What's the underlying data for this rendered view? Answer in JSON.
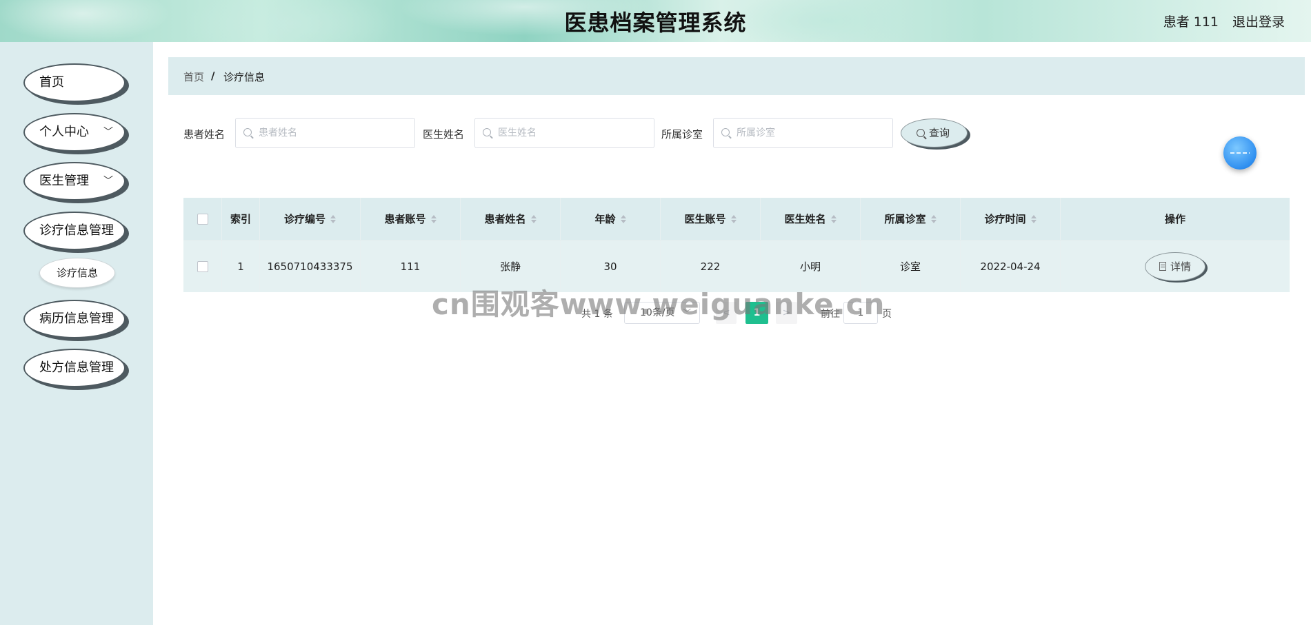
{
  "header": {
    "title": "医患档案管理系统",
    "user": "患者 111",
    "logout": "退出登录"
  },
  "sidebar": {
    "items": [
      {
        "label": "首页"
      },
      {
        "label": "个人中心",
        "chevron": "chevron-down-icon"
      },
      {
        "label": "医生管理",
        "chevron": "chevron-down-icon"
      },
      {
        "label": "诊疗信息管理"
      },
      {
        "label": "病历信息管理"
      },
      {
        "label": "处方信息管理"
      }
    ],
    "subitem": {
      "label": "诊疗信息"
    }
  },
  "breadcrumb": {
    "home": "首页",
    "separator": "/",
    "current": "诊疗信息"
  },
  "search": {
    "patient_name_label": "患者姓名",
    "patient_name_placeholder": "患者姓名",
    "doctor_name_label": "医生姓名",
    "doctor_name_placeholder": "医生姓名",
    "clinic_label": "所属诊室",
    "clinic_placeholder": "所属诊室",
    "query_label": "查询"
  },
  "table": {
    "columns": [
      "索引",
      "诊疗编号",
      "患者账号",
      "患者姓名",
      "年龄",
      "医生账号",
      "医生姓名",
      "所属诊室",
      "诊疗时间",
      "操作"
    ],
    "rows": [
      [
        "1",
        "1650710433375",
        "111",
        "张静",
        "30",
        "222",
        "小明",
        "诊室",
        "2022-04-24"
      ]
    ],
    "detail_label": "详情"
  },
  "pagination": {
    "total": "共 1 条",
    "page_size": "10条/页",
    "prev": "<",
    "current_page": "1",
    "next": ">",
    "goto": "前往",
    "goto_value": "1",
    "page": "页"
  },
  "watermark": "cn围观客www.weiguanke.cn",
  "colors": {
    "accent": "#1fbf8f",
    "panel": "#dcecee",
    "border_dark": "#4e5a60"
  }
}
